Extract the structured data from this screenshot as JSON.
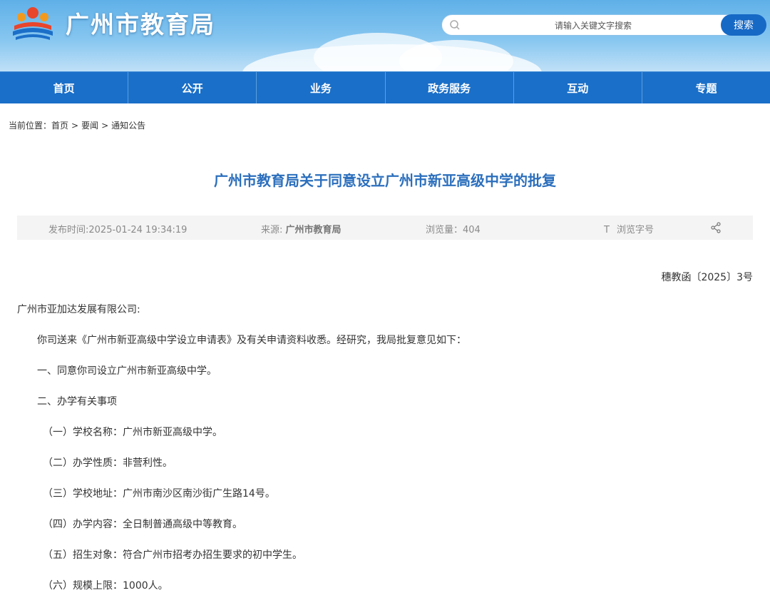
{
  "header": {
    "site_title": "广州市教育局",
    "search_placeholder": "请输入关键文字搜索",
    "search_button": "搜索"
  },
  "nav": [
    "首页",
    "公开",
    "业务",
    "政务服务",
    "互动",
    "专题"
  ],
  "breadcrumb": {
    "prefix": "当前位置：",
    "items": [
      "首页",
      "要闻",
      "通知公告"
    ],
    "separator": ">"
  },
  "article": {
    "title": "广州市教育局关于同意设立广州市新亚高级中学的批复",
    "publish_time": "发布时间:2025-01-24 19:34:19",
    "source_label": "来源: ",
    "source_value": "广州市教育局",
    "views": "浏览量：404",
    "font_size_label": "浏览字号",
    "doc_number": "穗教函〔2025〕3号",
    "addressee": "广州市亚加达发展有限公司:",
    "paragraphs": [
      "你司送来《广州市新亚高级中学设立申请表》及有关申请资料收悉。经研究，我局批复意见如下：",
      "一、同意你司设立广州市新亚高级中学。",
      "二、办学有关事项"
    ],
    "sub_items": [
      "（一）学校名称：广州市新亚高级中学。",
      "（二）办学性质：非营利性。",
      "（三）学校地址：广州市南沙区南沙街广生路14号。",
      "（四）办学内容：全日制普通高级中等教育。",
      "（五）招生对象：符合广州市招考办招生要求的初中学生。",
      "（六）规模上限：1000人。"
    ]
  },
  "icons": {
    "search": "search-icon",
    "font": "font-size-icon",
    "share": "share-icon",
    "logo": "logo-icon"
  },
  "colors": {
    "nav_bg": "#1a6fc8",
    "title": "#2c6fbd",
    "search_button": "#1769c6"
  }
}
